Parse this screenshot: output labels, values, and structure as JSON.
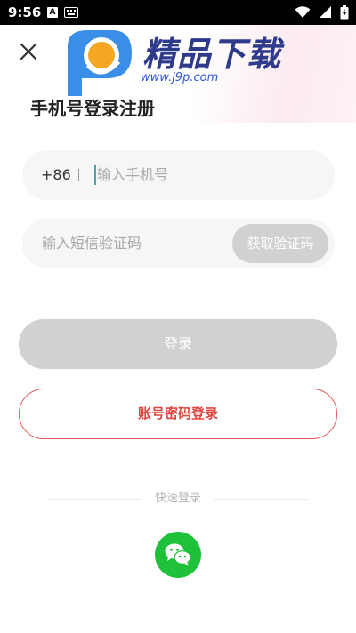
{
  "status_bar": {
    "time": "9:56",
    "notification_badge": "A",
    "icons": [
      "keyboard-icon",
      "wifi-icon",
      "signal-icon",
      "battery-icon"
    ]
  },
  "banner": {
    "logo_text": "精品下载",
    "logo_url": "www.j9p.com"
  },
  "page_title": "手机号登录注册",
  "phone": {
    "prefix": "+86",
    "value": "",
    "placeholder": "输入手机号"
  },
  "sms_code": {
    "value": "",
    "placeholder": "输入短信验证码",
    "get_code_label": "获取验证码"
  },
  "login_button": "登录",
  "password_login_button": "账号密码登录",
  "quick_login": {
    "label": "快速登录",
    "providers": [
      "wechat"
    ]
  },
  "colors": {
    "accent_red": "#e0453f",
    "disabled_gray": "#d1d1d1",
    "input_bg": "#f6f6f6",
    "wechat_green": "#1fc13b",
    "logo_blue": "#2e3a8c"
  }
}
